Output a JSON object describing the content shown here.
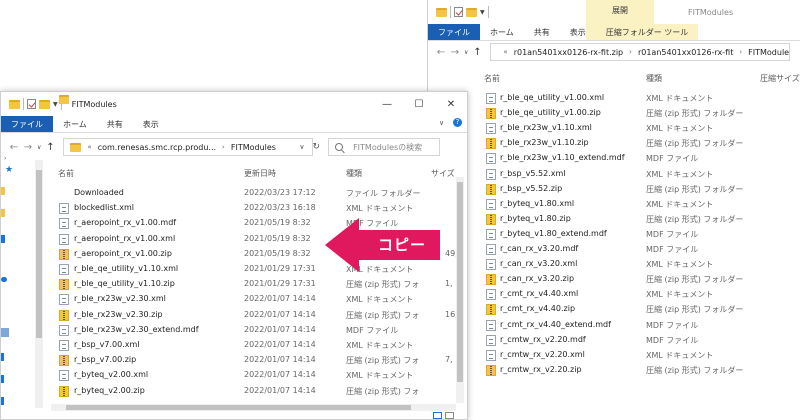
{
  "back_window": {
    "title": "FITModules",
    "manage_tab": "展開",
    "tabs": [
      "ファイル",
      "ホーム",
      "共有",
      "表示",
      "圧縮フォルダー ツール"
    ],
    "breadcrumb": [
      "r01an5401xx0126-rx-fit.zip",
      "r01an5401xx0126-rx-fit",
      "FITModules"
    ],
    "columns": {
      "name": "名前",
      "type": "種類",
      "size": "圧縮サイズ"
    },
    "files": [
      {
        "name": "r_ble_qe_utility_v1.00.xml",
        "type": "XML ドキュメント",
        "kind": "xml"
      },
      {
        "name": "r_ble_qe_utility_v1.00.zip",
        "type": "圧縮 (zip 形式) フォルダー",
        "kind": "zip"
      },
      {
        "name": "r_ble_rx23w_v1.10.xml",
        "type": "XML ドキュメント",
        "kind": "xml"
      },
      {
        "name": "r_ble_rx23w_v1.10.zip",
        "type": "圧縮 (zip 形式) フォルダー",
        "kind": "zip"
      },
      {
        "name": "r_ble_rx23w_v1.10_extend.mdf",
        "type": "MDF ファイル",
        "kind": "xml"
      },
      {
        "name": "r_bsp_v5.52.xml",
        "type": "XML ドキュメント",
        "kind": "xml"
      },
      {
        "name": "r_bsp_v5.52.zip",
        "type": "圧縮 (zip 形式) フォルダー",
        "kind": "zip"
      },
      {
        "name": "r_byteq_v1.80.xml",
        "type": "XML ドキュメント",
        "kind": "xml"
      },
      {
        "name": "r_byteq_v1.80.zip",
        "type": "圧縮 (zip 形式) フォルダー",
        "kind": "zip"
      },
      {
        "name": "r_byteq_v1.80_extend.mdf",
        "type": "MDF ファイル",
        "kind": "xml"
      },
      {
        "name": "r_can_rx_v3.20.mdf",
        "type": "MDF ファイル",
        "kind": "xml"
      },
      {
        "name": "r_can_rx_v3.20.xml",
        "type": "XML ドキュメント",
        "kind": "xml"
      },
      {
        "name": "r_can_rx_v3.20.zip",
        "type": "圧縮 (zip 形式) フォルダー",
        "kind": "zip"
      },
      {
        "name": "r_cmt_rx_v4.40.xml",
        "type": "XML ドキュメント",
        "kind": "xml"
      },
      {
        "name": "r_cmt_rx_v4.40.zip",
        "type": "圧縮 (zip 形式) フォルダー",
        "kind": "zip"
      },
      {
        "name": "r_cmt_rx_v4.40_extend.mdf",
        "type": "MDF ファイル",
        "kind": "xml"
      },
      {
        "name": "r_cmtw_rx_v2.20.mdf",
        "type": "MDF ファイル",
        "kind": "xml"
      },
      {
        "name": "r_cmtw_rx_v2.20.xml",
        "type": "XML ドキュメント",
        "kind": "xml"
      },
      {
        "name": "r_cmtw_rx_v2.20.zip",
        "type": "圧縮 (zip 形式) フォルダー",
        "kind": "zip"
      }
    ]
  },
  "front_window": {
    "title": "FITModules",
    "tabs": [
      "ファイル",
      "ホーム",
      "共有",
      "表示"
    ],
    "breadcrumb": [
      "com.renesas.smc.rcp.produ...",
      "FITModules"
    ],
    "search_placeholder": "FITModulesの検索",
    "columns": {
      "name": "名前",
      "date": "更新日時",
      "type": "種類",
      "size": "サイズ"
    },
    "files": [
      {
        "name": "Downloaded",
        "date": "2022/03/23 17:12",
        "type": "ファイル フォルダー",
        "size": "",
        "kind": "folder"
      },
      {
        "name": "blockedlist.xml",
        "date": "2022/03/23 16:18",
        "type": "XML ドキュメント",
        "size": "",
        "kind": "xml"
      },
      {
        "name": "r_aeropoint_rx_v1.00.mdf",
        "date": "2021/05/19 8:32",
        "type": "MDF ファイル",
        "size": "",
        "kind": "xml"
      },
      {
        "name": "r_aeropoint_rx_v1.00.xml",
        "date": "2021/05/19 8:32",
        "type": "XML ドキュメント",
        "size": "",
        "kind": "xml"
      },
      {
        "name": "r_aeropoint_rx_v1.00.zip",
        "date": "2021/05/19 8:32",
        "type": "圧縮 (",
        "size": "49,5",
        "kind": "zip"
      },
      {
        "name": "r_ble_qe_utility_v1.10.xml",
        "date": "2021/01/29 17:31",
        "type": "XML ドキュメント",
        "size": "",
        "kind": "xml"
      },
      {
        "name": "r_ble_qe_utility_v1.10.zip",
        "date": "2021/01/29 17:31",
        "type": "圧縮 (zip 形式) フォ",
        "size": "1,",
        "kind": "zip"
      },
      {
        "name": "r_ble_rx23w_v2.30.xml",
        "date": "2022/01/07 14:14",
        "type": "XML ドキュメント",
        "size": "",
        "kind": "xml"
      },
      {
        "name": "r_ble_rx23w_v2.30.zip",
        "date": "2022/01/07 14:14",
        "type": "圧縮 (zip 形式) フォ",
        "size": "16,",
        "kind": "zip"
      },
      {
        "name": "r_ble_rx23w_v2.30_extend.mdf",
        "date": "2022/01/07 14:14",
        "type": "MDF ファイル",
        "size": "",
        "kind": "xml"
      },
      {
        "name": "r_bsp_v7.00.xml",
        "date": "2022/01/07 14:14",
        "type": "XML ドキュメント",
        "size": "",
        "kind": "xml"
      },
      {
        "name": "r_bsp_v7.00.zip",
        "date": "2022/01/07 14:14",
        "type": "圧縮 (zip 形式) フォ",
        "size": "7,",
        "kind": "zip"
      },
      {
        "name": "r_byteq_v2.00.xml",
        "date": "2022/01/07 14:14",
        "type": "XML ドキュメント",
        "size": "",
        "kind": "xml"
      },
      {
        "name": "r_byteq_v2.00.zip",
        "date": "2022/01/07 14:14",
        "type": "圧縮 (zip 形式) フォ",
        "size": "",
        "kind": "zip"
      }
    ]
  },
  "annotation": {
    "label": "コピー",
    "color": "#e0185e"
  },
  "colors": {
    "file_tab": "#1a5fb4",
    "manage_tab": "#fbf2c4",
    "accent": "#1a73d6"
  }
}
